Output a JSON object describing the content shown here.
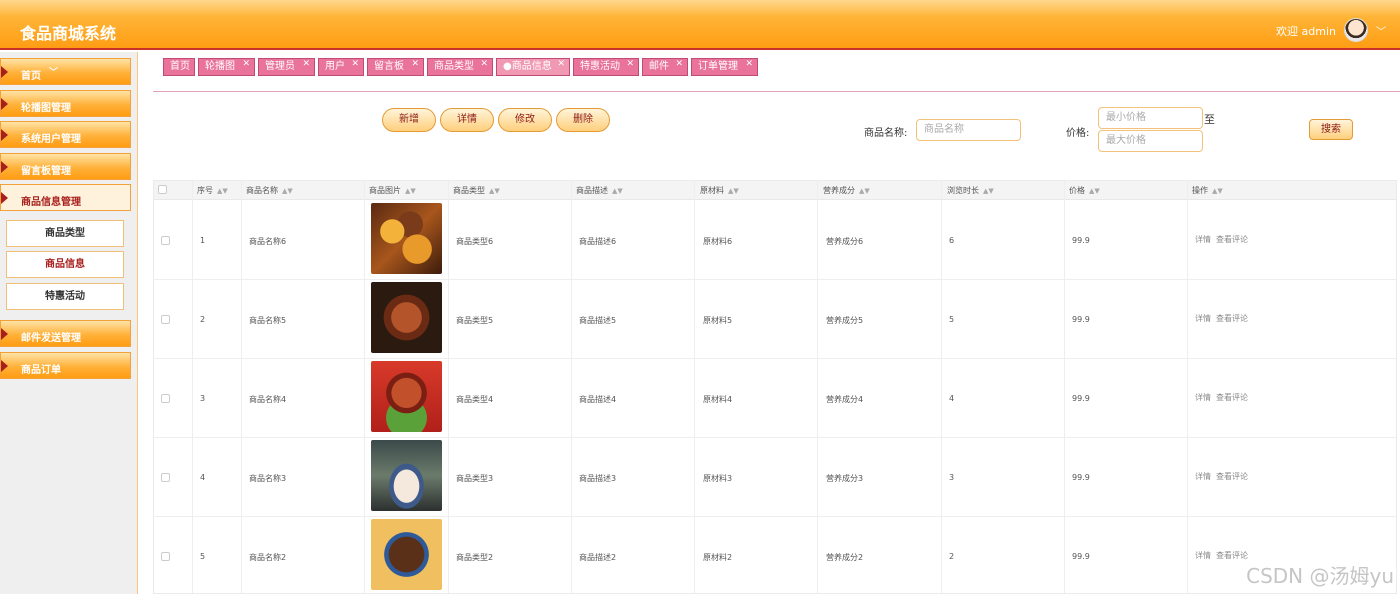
{
  "header": {
    "title": "食品商城系统",
    "welcome": "欢迎 admin",
    "caret": "﹀"
  },
  "sidebar": {
    "items": [
      {
        "label": "首页"
      },
      {
        "label": "轮播图管理"
      },
      {
        "label": "系统用户管理"
      },
      {
        "label": "留言板管理"
      },
      {
        "label": "商品信息管理"
      },
      {
        "label": "邮件发送管理"
      },
      {
        "label": "商品订单"
      }
    ],
    "home_chevron": "﹀",
    "submenu": [
      {
        "label": "商品类型"
      },
      {
        "label": "商品信息"
      },
      {
        "label": "特惠活动"
      }
    ]
  },
  "tabs": [
    {
      "label": "首页"
    },
    {
      "label": "轮播图"
    },
    {
      "label": "管理员"
    },
    {
      "label": "用户"
    },
    {
      "label": "留言板"
    },
    {
      "label": "商品类型"
    },
    {
      "label": "●商品信息"
    },
    {
      "label": "特惠活动"
    },
    {
      "label": "邮件"
    },
    {
      "label": "订单管理"
    }
  ],
  "tab_close": "✕",
  "toolbar": {
    "add": "新增",
    "detail": "详情",
    "edit": "修改",
    "delete": "删除"
  },
  "search": {
    "name_label": "商品名称:",
    "name_placeholder": "商品名称",
    "price_label": "价格:",
    "min_placeholder": "最小价格",
    "max_placeholder": "最大价格",
    "to": "至",
    "button": "搜索"
  },
  "table": {
    "headers": [
      "序号",
      "商品名称",
      "商品图片",
      "商品类型",
      "商品描述",
      "原材料",
      "营养成分",
      "浏览时长",
      "价格",
      "操作"
    ],
    "sort_glyph": "▲▼",
    "rows": [
      {
        "no": "1",
        "name": "商品名称6",
        "type": "商品类型6",
        "desc": "商品描述6",
        "material": "原材料6",
        "nutrition": "营养成分6",
        "browse": "6",
        "price": "99.9",
        "op_detail": "详情",
        "op_comment": "查看评论"
      },
      {
        "no": "2",
        "name": "商品名称5",
        "type": "商品类型5",
        "desc": "商品描述5",
        "material": "原材料5",
        "nutrition": "营养成分5",
        "browse": "5",
        "price": "99.9",
        "op_detail": "详情",
        "op_comment": "查看评论"
      },
      {
        "no": "3",
        "name": "商品名称4",
        "type": "商品类型4",
        "desc": "商品描述4",
        "material": "原材料4",
        "nutrition": "营养成分4",
        "browse": "4",
        "price": "99.9",
        "op_detail": "详情",
        "op_comment": "查看评论"
      },
      {
        "no": "4",
        "name": "商品名称3",
        "type": "商品类型3",
        "desc": "商品描述3",
        "material": "原材料3",
        "nutrition": "营养成分3",
        "browse": "3",
        "price": "99.9",
        "op_detail": "详情",
        "op_comment": "查看评论"
      },
      {
        "no": "5",
        "name": "商品名称2",
        "type": "商品类型2",
        "desc": "商品描述2",
        "material": "原材料2",
        "nutrition": "营养成分2",
        "browse": "2",
        "price": "99.9",
        "op_detail": "详情",
        "op_comment": "查看评论"
      }
    ]
  },
  "watermark": "CSDN @汤姆yu",
  "colors": {
    "header_orange": "#ff9d14",
    "accent_red": "#a8201d",
    "tab_pink": "#e9739a"
  }
}
